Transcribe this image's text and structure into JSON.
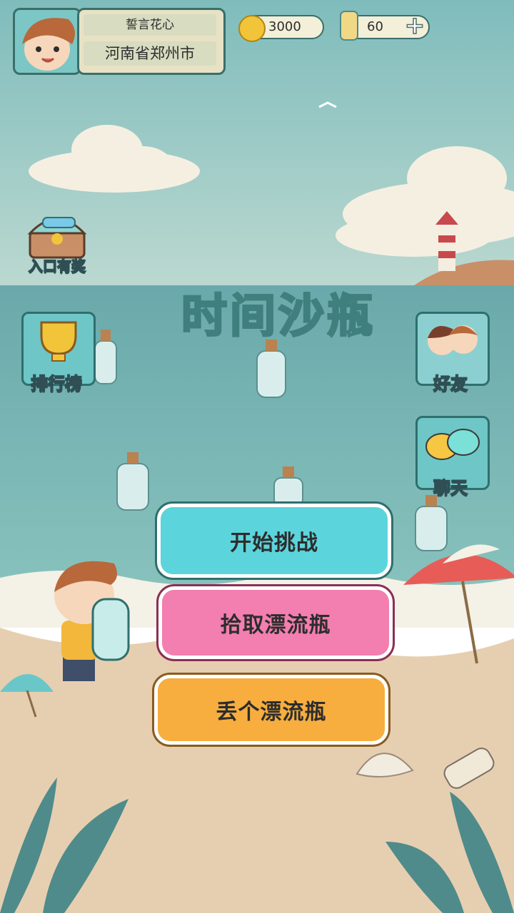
{
  "player": {
    "name": "誓言花心",
    "location": "河南省郑州市",
    "avatar": "avatar"
  },
  "currency": {
    "coins": "3000",
    "bottles": "60"
  },
  "title": "时间沙瓶",
  "side_buttons": {
    "treasure": "入口有奖",
    "ranking": "排行榜",
    "friends": "好友",
    "chat": "聊天"
  },
  "main_buttons": {
    "start": "开始挑战",
    "pick": "拾取漂流瓶",
    "throw": "丢个漂流瓶"
  },
  "colors": {
    "start": "#5cd4dc",
    "pick": "#f37eb0",
    "throw": "#f7ae3e",
    "sea": "#78b7b5",
    "sand": "#e7d0b2"
  }
}
